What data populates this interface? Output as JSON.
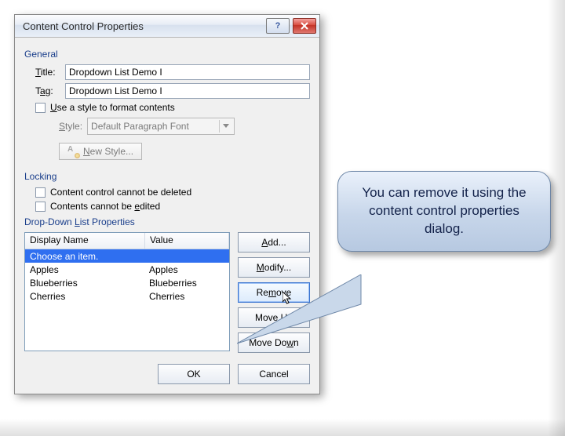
{
  "dialog": {
    "title": "Content Control Properties"
  },
  "general": {
    "label": "General",
    "title_label": "Title:",
    "title_value": "Dropdown List Demo I",
    "tag_label": "Tag:",
    "tag_value": "Dropdown List Demo I",
    "use_style_label_pre": "U",
    "use_style_label_post": "se a style to format contents",
    "style_label": "Style:",
    "style_value": "Default Paragraph Font",
    "new_style_label": "New Style..."
  },
  "locking": {
    "label": "Locking",
    "cannot_delete": "Content control cannot be deleted",
    "cannot_edit_pre": "Contents cannot be ",
    "cannot_edit_u": "e",
    "cannot_edit_post": "dited"
  },
  "dd": {
    "label_pre": "Drop-Down ",
    "label_u": "L",
    "label_post": "ist Properties",
    "col_display": "Display Name",
    "col_value": "Value",
    "rows": [
      {
        "display": "Choose an item.",
        "value": "",
        "selected": true
      },
      {
        "display": "Apples",
        "value": "Apples"
      },
      {
        "display": "Blueberries",
        "value": "Blueberries"
      },
      {
        "display": "Cherries",
        "value": "Cherries"
      }
    ],
    "btn_add": "Add...",
    "btn_modify": "Modify...",
    "btn_remove": "Remove",
    "btn_moveup": "Move Up",
    "btn_movedown": "Move Down"
  },
  "footer": {
    "ok": "OK",
    "cancel": "Cancel"
  },
  "callout": {
    "text": "You can remove it using the content control properties dialog."
  }
}
